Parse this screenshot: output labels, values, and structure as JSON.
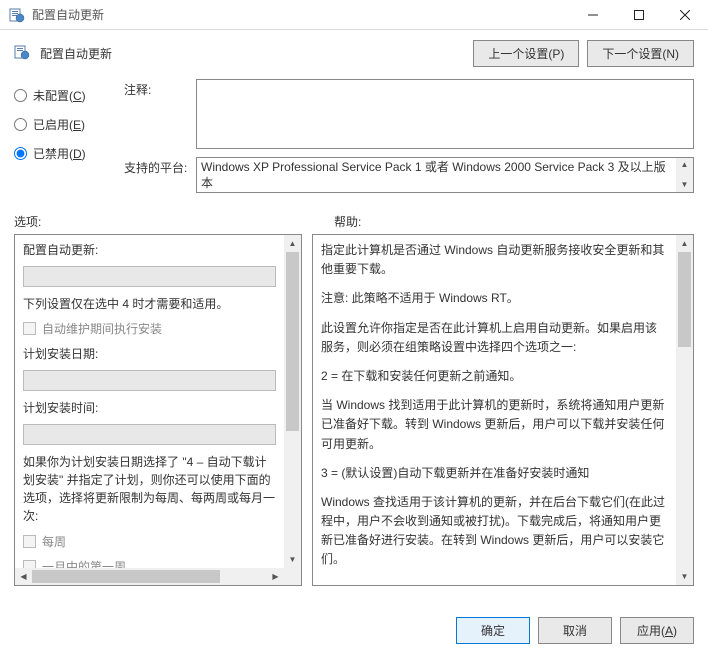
{
  "window": {
    "title": "配置自动更新",
    "header_title": "配置自动更新"
  },
  "nav": {
    "prev": "上一个设置(",
    "prev_hotkey": "P",
    "prev_suffix": ")",
    "next": "下一个设置(",
    "next_hotkey": "N",
    "next_suffix": ")"
  },
  "radios": {
    "not_configured": "未配置(",
    "not_configured_hotkey": "C",
    "enabled": "已启用(",
    "enabled_hotkey": "E",
    "disabled": "已禁用(",
    "disabled_hotkey": "D",
    "suffix": ")",
    "selected": "disabled"
  },
  "labels": {
    "comment": "注释:",
    "platform": "支持的平台:",
    "options": "选项:",
    "help": "帮助:"
  },
  "platform_text": "Windows XP Professional Service Pack 1 或者 Windows 2000 Service Pack 3 及以上版本",
  "options": {
    "header": "配置自动更新:",
    "note": "下列设置仅在选中 4 时才需要和适用。",
    "chk_maintenance": "自动维护期间执行安装",
    "install_day": "计划安装日期:",
    "install_time": "计划安装时间:",
    "explain": "如果你为计划安装日期选择了 \"4 – 自动下载计划安装\" 并指定了计划，则你还可以使用下面的选项，选择将更新限制为每周、每两周或每月一次:",
    "chk_weekly": "每周",
    "chk_first_week": "一月中的第一周"
  },
  "help": {
    "p1": "指定此计算机是否通过 Windows 自动更新服务接收安全更新和其他重要下载。",
    "p2": "注意: 此策略不适用于 Windows RT。",
    "p3": "此设置允许你指定是否在此计算机上启用自动更新。如果启用该服务，则必须在组策略设置中选择四个选项之一:",
    "p4": "2 = 在下载和安装任何更新之前通知。",
    "p5": " 当 Windows 找到适用于此计算机的更新时，系统将通知用户更新已准备好下载。转到 Windows 更新后，用户可以下载并安装任何可用更新。",
    "p6": "3 = (默认设置)自动下载更新并在准备好安装时通知",
    "p7": " Windows 查找适用于该计算机的更新，并在后台下载它们(在此过程中，用户不会收到通知或被打扰)。下载完成后，将通知用户更新已准备好进行安装。在转到 Windows 更新后，用户可以安装它们。"
  },
  "footer": {
    "ok": "确定",
    "cancel": "取消",
    "apply": "应用(",
    "apply_hotkey": "A",
    "apply_suffix": ")"
  }
}
